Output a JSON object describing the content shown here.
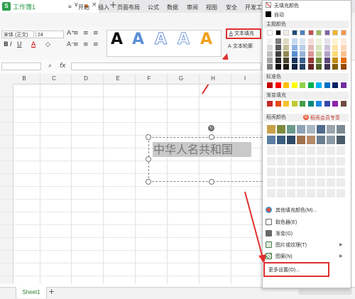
{
  "titlebar": {
    "doc_name": "工作簿1",
    "add_tab": "+",
    "tab_more": "∨",
    "tab_close": "×"
  },
  "menu": [
    "≡",
    "开始",
    "插入",
    "页面布局",
    "公式",
    "数据",
    "审阅",
    "视图",
    "安全",
    "开发工"
  ],
  "ribbon": {
    "font_name": "宋体 (正文)",
    "font_size": "24",
    "art_samples": [
      {
        "label": "A",
        "color": "#111111"
      },
      {
        "label": "A",
        "color": "#5b8fd6"
      },
      {
        "label": "A",
        "color": "#6a8fd8"
      },
      {
        "label": "A",
        "color": "#7aa0dd"
      },
      {
        "label": "A",
        "color": "#f2a01e"
      }
    ],
    "text_fill_label": "文本填充",
    "text_outline_label": "文本轮廓"
  },
  "formula": {
    "zoom_icon": "search-icon",
    "fx": "fx"
  },
  "columns": [
    "B",
    "C",
    "D",
    "E",
    "F",
    "G",
    "H",
    "I"
  ],
  "textbox": {
    "text": "中华人名共和国"
  },
  "sheet": {
    "tab_label": "Sheet1",
    "add": "+"
  },
  "panel": {
    "no_fill": "无填充颜色",
    "auto": "自动",
    "theme_title": "主题颜色",
    "standard_title": "标准色",
    "gradient_title": "渐变填充",
    "member_title": "稻壳颜色",
    "member_badge": "稻壳会员专享",
    "more_colors": "其他填充颜色(M)...",
    "picker": "取色器(E)",
    "gradient": "渐变(G)",
    "texture": "图片或纹理(T)",
    "pattern": "图案(N)",
    "more_settings": "更多设置(O)...",
    "theme_top": [
      "#ffffff",
      "#000000",
      "#eeece1",
      "#1f497d",
      "#4f81bd",
      "#c0504d",
      "#9bbb59",
      "#8064a2",
      "#f2b522",
      "#f79646"
    ],
    "theme_shades": [
      [
        "#f2f2f2",
        "#7f7f7f",
        "#ddd9c3",
        "#c6d9f0",
        "#dbe5f1",
        "#f2dcdb",
        "#ebf1dd",
        "#e5e0ec",
        "#fdf2d0",
        "#fdeada"
      ],
      [
        "#d8d8d8",
        "#595959",
        "#c4bd97",
        "#8db3e2",
        "#b8cce4",
        "#e5b9b7",
        "#d7e3bc",
        "#ccc1d9",
        "#fbe5a2",
        "#fbd5b5"
      ],
      [
        "#bfbfbf",
        "#3f3f3f",
        "#938953",
        "#548dd4",
        "#95b3d7",
        "#d99694",
        "#c3d69b",
        "#b2a2c7",
        "#f8d975",
        "#fac08f"
      ],
      [
        "#a5a5a5",
        "#262626",
        "#494429",
        "#17365d",
        "#366092",
        "#953734",
        "#76923c",
        "#5f497a",
        "#c48d0c",
        "#e36c09"
      ],
      [
        "#7f7f7f",
        "#0c0c0c",
        "#1d1b10",
        "#0f243e",
        "#244061",
        "#632423",
        "#4f6128",
        "#3f3151",
        "#835e08",
        "#974806"
      ]
    ],
    "standard": [
      "#c00000",
      "#ff0000",
      "#ffc000",
      "#ffff00",
      "#92d050",
      "#00b050",
      "#00b0f0",
      "#0070c0",
      "#002060",
      "#7030a0"
    ],
    "gradient_swatches": [
      "#c62828",
      "#e64a19",
      "#fbc02d",
      "#c0ca33",
      "#43a047",
      "#00897b",
      "#1e88e5",
      "#3949ab",
      "#8e24aa",
      "#6d4c41"
    ],
    "member_row1": [
      "#c8a14a",
      "#7e8a3f",
      "#6c9a8b",
      "#8fa3b8",
      "#a9b7c2",
      "#4e6b8c",
      "#9aa5ad",
      "#7c8a94"
    ],
    "member_row2": [
      "#5d7fa3",
      "#3a5f7e",
      "#2f4a66",
      "#a0724f",
      "#b58b6a",
      "#6b7e90",
      "#8c9aa6",
      "#4b5b6a"
    ]
  }
}
